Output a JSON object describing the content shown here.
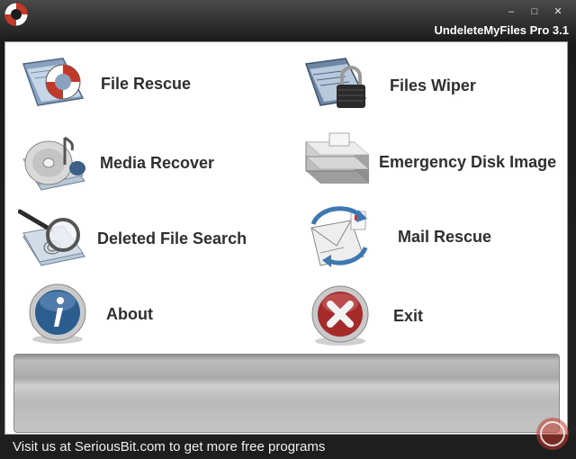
{
  "window": {
    "title": "UndeleteMyFiles Pro 3.1",
    "controls": [
      "minimize",
      "maximize",
      "close"
    ],
    "control_glyphs": [
      "–",
      "□",
      "✕"
    ]
  },
  "menu": {
    "file_rescue": "File Rescue",
    "files_wiper": "Files Wiper",
    "media_recover": "Media Recover",
    "emergency_disk_image": "Emergency Disk Image",
    "deleted_file_search": "Deleted File Search",
    "mail_rescue": "Mail Rescue",
    "about": "About",
    "exit": "Exit"
  },
  "footer": {
    "text": "Visit us at SeriousBit.com to get more free programs"
  },
  "icons": {
    "file_rescue": "lifebuoy-folder-icon",
    "files_wiper": "padlock-folder-icon",
    "media_recover": "music-cd-icon",
    "emergency_disk_image": "hard-disk-icon",
    "deleted_file_search": "magnifier-fingerprint-icon",
    "mail_rescue": "mail-arrow-icon",
    "about": "info-icon",
    "exit": "close-x-icon"
  },
  "colors": {
    "title_bar": "#1c1c1c",
    "footer": "#1e1e1e",
    "label": "#2f2f2f",
    "exit_red": "#a52a2a",
    "about_blue": "#2c5d8f",
    "lifebuoy_red": "#c0392b"
  }
}
